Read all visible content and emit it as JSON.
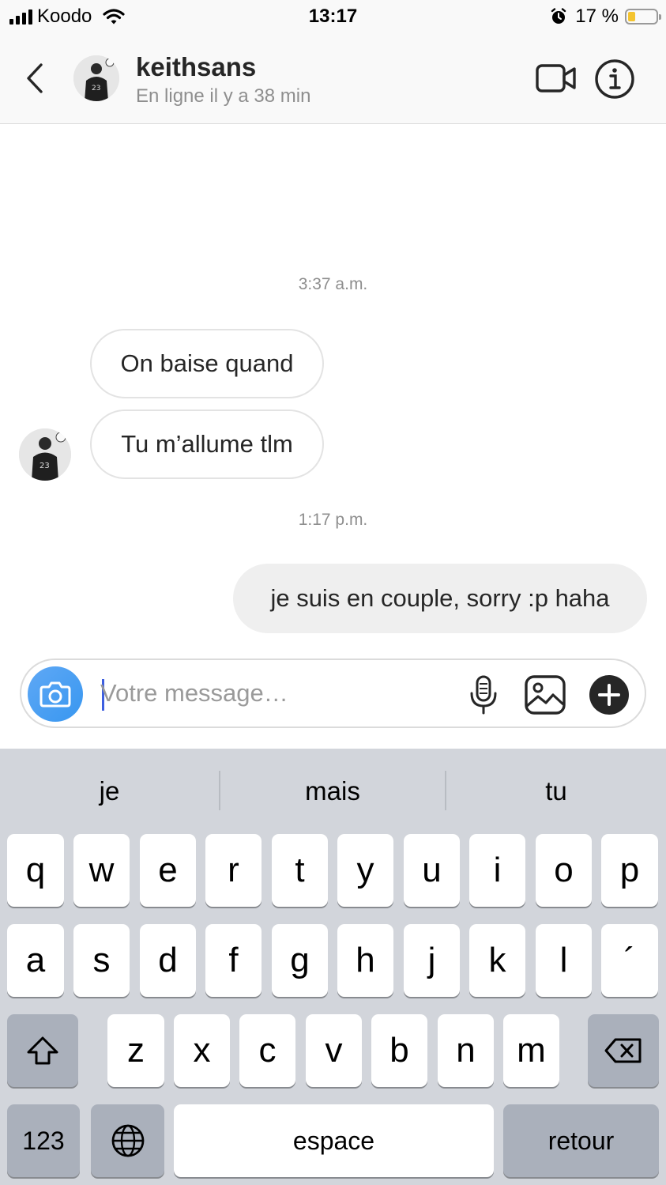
{
  "status_bar": {
    "carrier": "Koodo",
    "time": "13:17",
    "battery": "17 %",
    "battery_level": 0.17
  },
  "header": {
    "username": "keithsans",
    "status": "En ligne il y a 38 min",
    "icons": [
      "back-chevron-icon",
      "avatar",
      "video-camera-icon",
      "info-icon"
    ]
  },
  "conversation": {
    "timestamp_1": "3:37 a.m.",
    "incoming": [
      {
        "text": "On baise quand"
      },
      {
        "text": "Tu m’allume tlm"
      }
    ],
    "timestamp_2": "1:17 p.m.",
    "outgoing": [
      {
        "text": "je suis en couple, sorry :p haha"
      }
    ]
  },
  "composer": {
    "placeholder": "Votre message…",
    "value": "",
    "icons": [
      "camera-icon",
      "microphone-icon",
      "gallery-icon",
      "plus-icon"
    ]
  },
  "keyboard": {
    "suggestions": [
      "je",
      "mais",
      "tu"
    ],
    "row1": [
      "q",
      "w",
      "e",
      "r",
      "t",
      "y",
      "u",
      "i",
      "o",
      "p"
    ],
    "row2": [
      "a",
      "s",
      "d",
      "f",
      "g",
      "h",
      "j",
      "k",
      "l",
      "´"
    ],
    "row3": [
      "z",
      "x",
      "c",
      "v",
      "b",
      "n",
      "m"
    ],
    "numbers_label": "123",
    "space_label": "espace",
    "return_label": "retour",
    "icons": [
      "shift-icon",
      "backspace-icon",
      "globe-icon"
    ]
  },
  "colors": {
    "accent": "#3897f0",
    "bubble_out": "#efefef",
    "keyboard_bg": "#d2d5db",
    "battery_fill": "#f4c430"
  }
}
